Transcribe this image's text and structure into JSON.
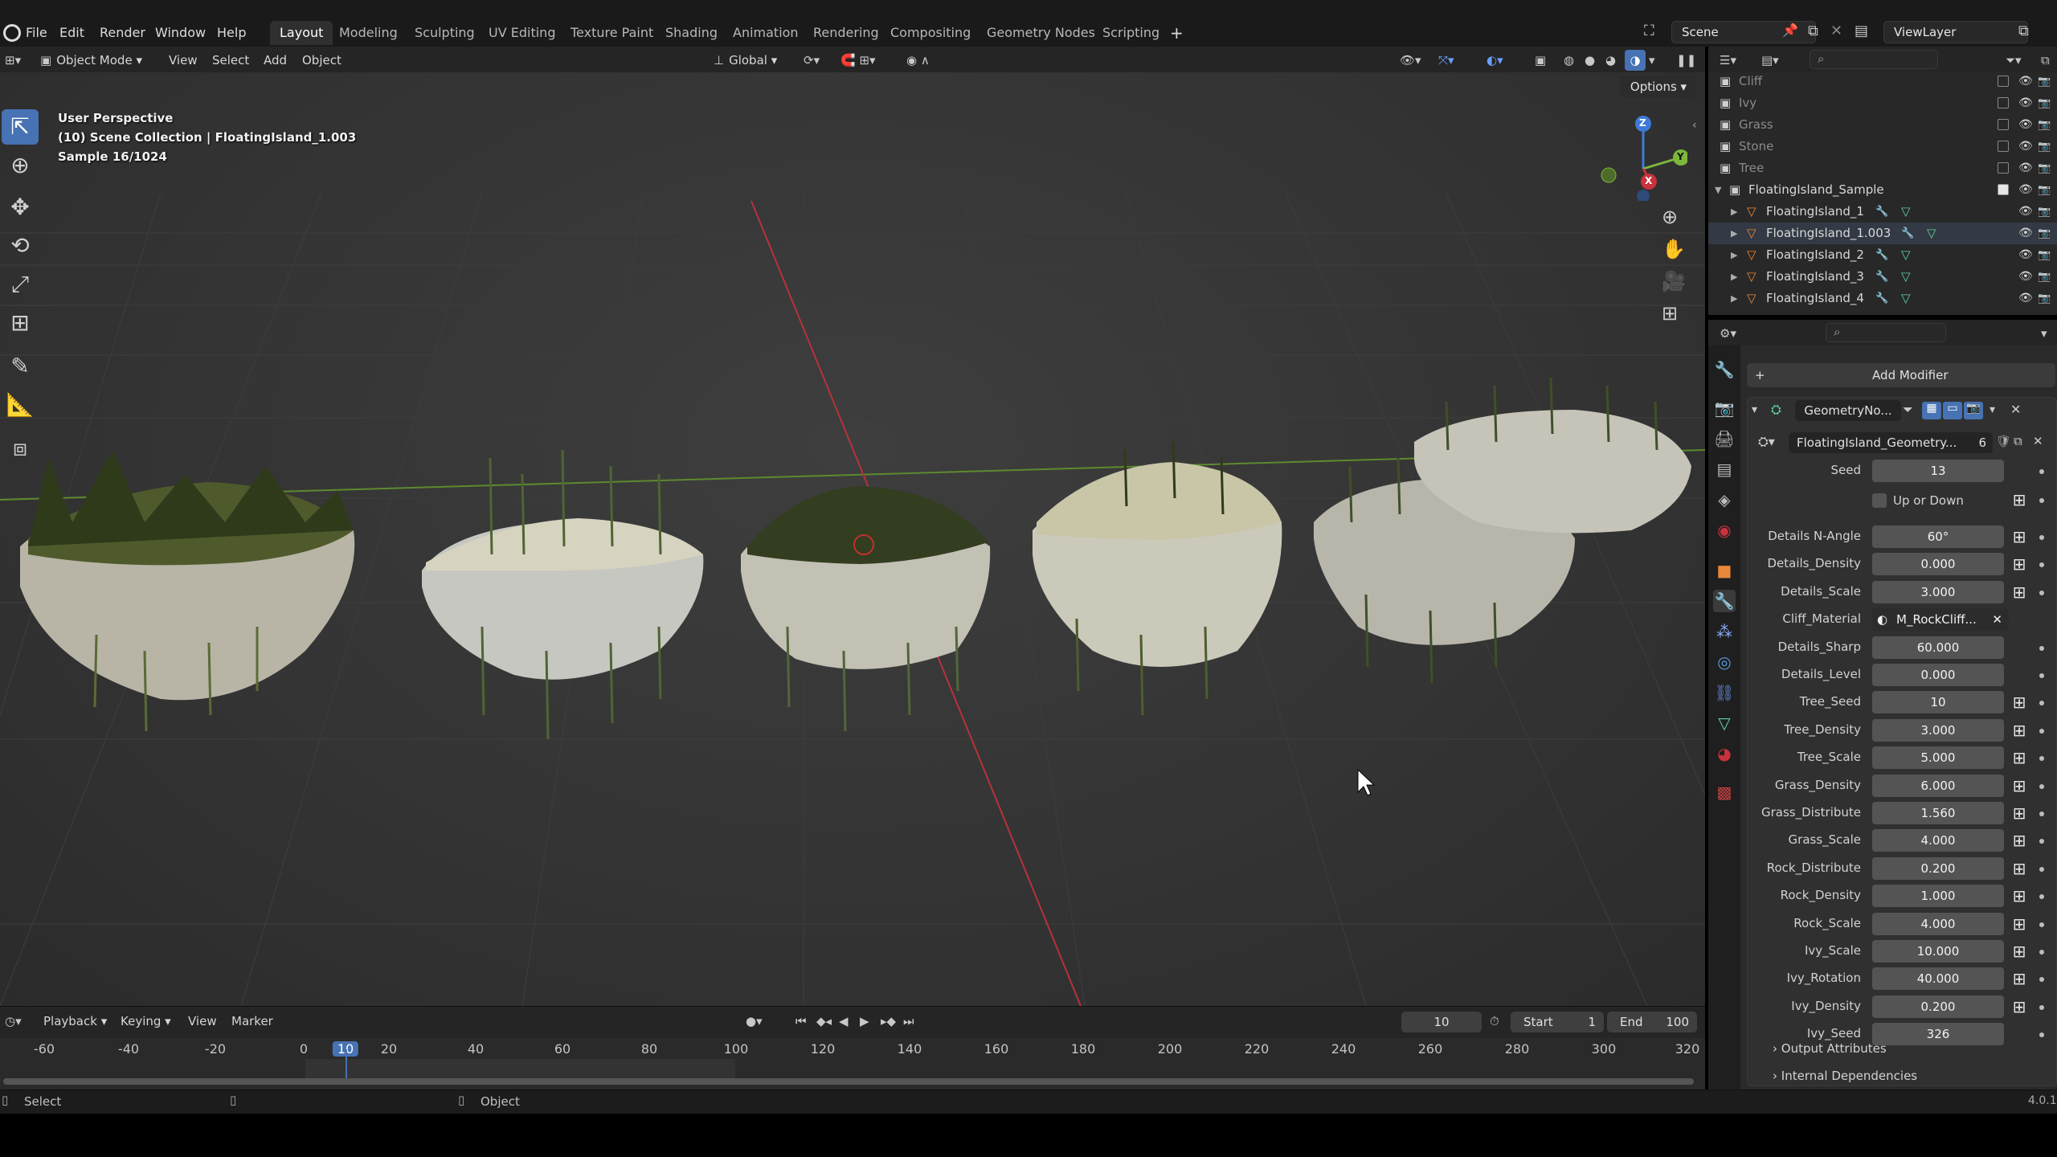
{
  "menu": {
    "items": [
      "File",
      "Edit",
      "Render",
      "Window",
      "Help"
    ],
    "workspaces": [
      "Layout",
      "Modeling",
      "Sculpting",
      "UV Editing",
      "Texture Paint",
      "Shading",
      "Animation",
      "Rendering",
      "Compositing",
      "Geometry Nodes",
      "Scripting"
    ],
    "active_workspace": "Layout",
    "add_tab": "+",
    "scene": "Scene",
    "view_layer": "ViewLayer"
  },
  "viewport_header": {
    "mode": "Object Mode",
    "menus": [
      "View",
      "Select",
      "Add",
      "Object"
    ],
    "transform": "Global",
    "options": "Options"
  },
  "viewport_overlay": {
    "line1": "User Perspective",
    "line2": "(10) Scene Collection | FloatingIsland_1.003",
    "line3": "Sample 16/1024"
  },
  "gizmo": {
    "x": "X",
    "y": "Y",
    "z": "Z"
  },
  "timeline": {
    "menus": [
      "Playback",
      "Keying",
      "View",
      "Marker"
    ],
    "current_frame": "10",
    "start_label": "Start",
    "start": "1",
    "end_label": "End",
    "end": "100",
    "ruler": [
      "-60",
      "-40",
      "-20",
      "0",
      "10",
      "20",
      "40",
      "60",
      "80",
      "100",
      "120",
      "140",
      "160",
      "180",
      "200",
      "220",
      "240",
      "260",
      "280",
      "300",
      "320"
    ],
    "ruler_current": "10"
  },
  "status": {
    "left": "Select",
    "middle": "Object",
    "version": "4.0.1"
  },
  "outliner": {
    "items": [
      {
        "name": "Cliff",
        "dim": true
      },
      {
        "name": "Ivy",
        "dim": true
      },
      {
        "name": "Grass",
        "dim": true
      },
      {
        "name": "Stone",
        "dim": true
      },
      {
        "name": "Tree",
        "dim": true
      },
      {
        "name": "FloatingIsland_Sample",
        "dim": false
      },
      {
        "name": "FloatingIsland_1",
        "dim": false
      },
      {
        "name": "FloatingIsland_1.003",
        "dim": false
      },
      {
        "name": "FloatingIsland_2",
        "dim": false
      },
      {
        "name": "FloatingIsland_3",
        "dim": false
      },
      {
        "name": "FloatingIsland_4",
        "dim": false
      }
    ]
  },
  "properties": {
    "add_modifier": "Add Modifier",
    "modifier_name": "GeometryNo...",
    "node_group": "FloatingIsland_Geometry...",
    "node_group_users": "6",
    "seed_label": "Seed",
    "seed_value": "13",
    "up_or_down": "Up or Down",
    "rows": [
      {
        "label": "Details N-Angle",
        "value": "60°"
      },
      {
        "label": "Details_Density",
        "value": "0.000"
      },
      {
        "label": "Details_Scale",
        "value": "3.000"
      },
      {
        "label": "Cliff_Material",
        "value": "M_RockCliff..."
      },
      {
        "label": "Details_Sharp",
        "value": "60.000"
      },
      {
        "label": "Details_Level",
        "value": "0.000"
      },
      {
        "label": "Tree_Seed",
        "value": "10"
      },
      {
        "label": "Tree_Density",
        "value": "3.000"
      },
      {
        "label": "Tree_Scale",
        "value": "5.000"
      },
      {
        "label": "Grass_Density",
        "value": "6.000"
      },
      {
        "label": "Grass_Distribute",
        "value": "1.560"
      },
      {
        "label": "Grass_Scale",
        "value": "4.000"
      },
      {
        "label": "Rock_Distribute",
        "value": "0.200"
      },
      {
        "label": "Rock_Density",
        "value": "1.000"
      },
      {
        "label": "Rock_Scale",
        "value": "4.000"
      },
      {
        "label": "Ivy_Scale",
        "value": "10.000"
      },
      {
        "label": "Ivy_Rotation",
        "value": "40.000"
      },
      {
        "label": "Ivy_Density",
        "value": "0.200"
      },
      {
        "label": "Ivy_Seed",
        "value": "326"
      }
    ],
    "output_attributes": "Output Attributes",
    "internal_dependencies": "Internal Dependencies"
  },
  "colors": {
    "accent": "#4772b3",
    "x_axis": "#c8323c",
    "y_axis": "#7db83a",
    "z_axis": "#3d7ad6",
    "object_orange": "#e8873a",
    "mesh_green": "#5fd39e"
  }
}
